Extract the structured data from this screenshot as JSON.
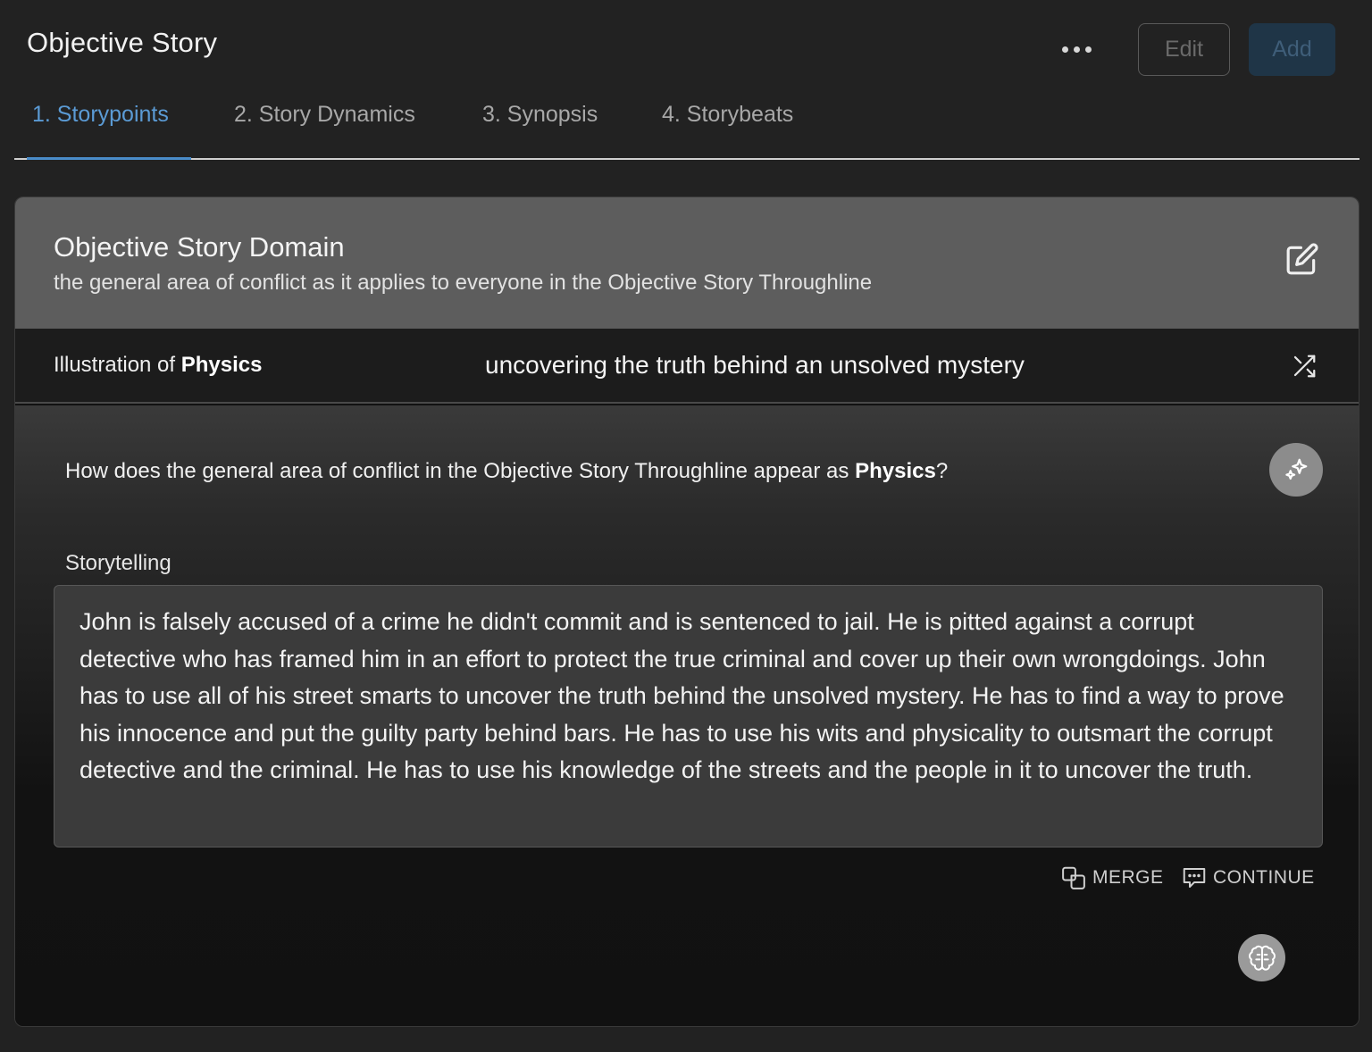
{
  "header": {
    "title": "Objective Story",
    "more_icon": "more-horizontal-icon",
    "edit_label": "Edit",
    "add_label": "Add"
  },
  "tabs": [
    {
      "label": "1. Storypoints",
      "active": true
    },
    {
      "label": "2. Story Dynamics",
      "active": false
    },
    {
      "label": "3. Synopsis",
      "active": false
    },
    {
      "label": "4. Storybeats",
      "active": false
    }
  ],
  "card": {
    "title": "Objective Story Domain",
    "subtitle": "the general area of conflict as it applies to everyone in the Objective Story Throughline",
    "edit_icon": "edit-icon",
    "illustration": {
      "prefix": "Illustration of ",
      "term": "Physics",
      "value": "uncovering the truth behind an unsolved mystery",
      "shuffle_icon": "shuffle-icon"
    },
    "question": {
      "prefix": "How does the general area of conflict in the Objective Story Throughline appear as ",
      "term": "Physics",
      "suffix": "?"
    },
    "sparkle_icon": "sparkle-icon",
    "storytelling_label": "Storytelling",
    "storytelling_text": "John is falsely accused of a crime he didn't commit and is sentenced to jail. He is pitted against a corrupt detective who has framed him in an effort to protect the true criminal and cover up their own wrongdoings. John has to use all of his street smarts to uncover the truth behind the unsolved mystery. He has to find a way to prove his innocence and put the guilty party behind bars. He has to use his wits and physicality to outsmart the corrupt detective and the criminal. He has to use his knowledge of the streets and the people in it to uncover the truth.",
    "merge_label": "MERGE",
    "continue_label": "CONTINUE",
    "brain_icon": "brain-icon"
  },
  "colors": {
    "accent": "#5b9bd5",
    "background": "#222222",
    "card_header": "#5d5d5d",
    "textbox": "#3b3b3b"
  }
}
